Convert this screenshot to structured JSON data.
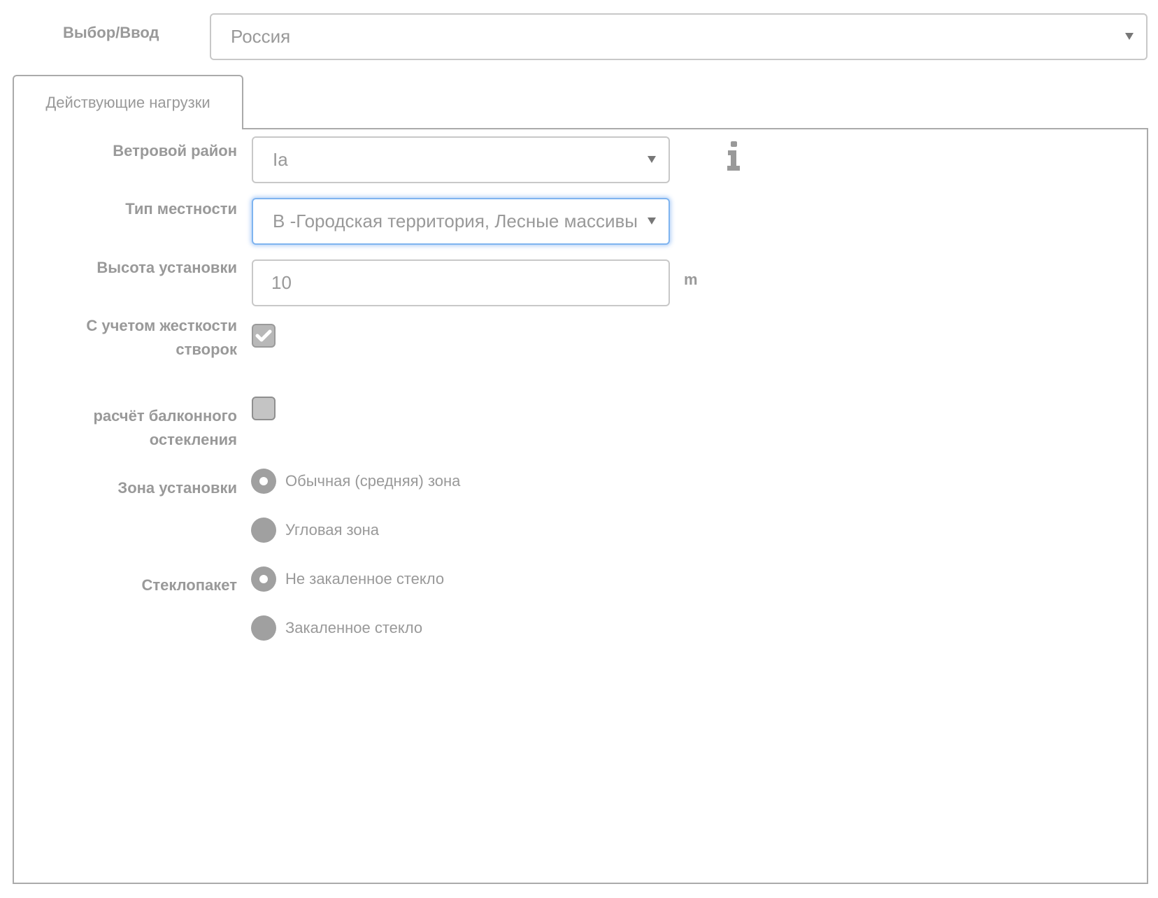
{
  "header": {
    "select_label": "Выбор/Ввод",
    "country_value": "Россия"
  },
  "tabs": [
    {
      "label": "Действующие нагрузки",
      "active": true
    }
  ],
  "form": {
    "wind_region": {
      "label": "Ветровой район",
      "value": "Ia"
    },
    "terrain_type": {
      "label": "Тип местности",
      "value": "В -Городская территория, Лесные массивы"
    },
    "install_height": {
      "label": "Высота установки",
      "value": "10",
      "unit": "m"
    },
    "sash_stiffness": {
      "label_line1": "С учетом жесткости",
      "label_line2": "створок",
      "checked": true
    },
    "balcony_glazing": {
      "label_line1": "расчёт балконного",
      "label_line2": "остекления",
      "checked": false
    },
    "install_zone": {
      "label": "Зона установки",
      "options": [
        {
          "label": "Обычная (средняя) зона",
          "selected": true
        },
        {
          "label": "Угловая зона",
          "selected": false
        }
      ]
    },
    "glass_unit": {
      "label": "Стеклопакет",
      "options": [
        {
          "label": "Не закаленное стекло",
          "selected": true
        },
        {
          "label": "Закаленное стекло",
          "selected": false
        }
      ]
    }
  },
  "icons": {
    "info": "info-icon",
    "checkmark": "checkmark-icon",
    "caret": "chevron-down-icon"
  },
  "colors": {
    "text": "#999999",
    "border": "#c8c8c8",
    "focus": "#7fb4f0",
    "control": "#a0a0a0"
  }
}
